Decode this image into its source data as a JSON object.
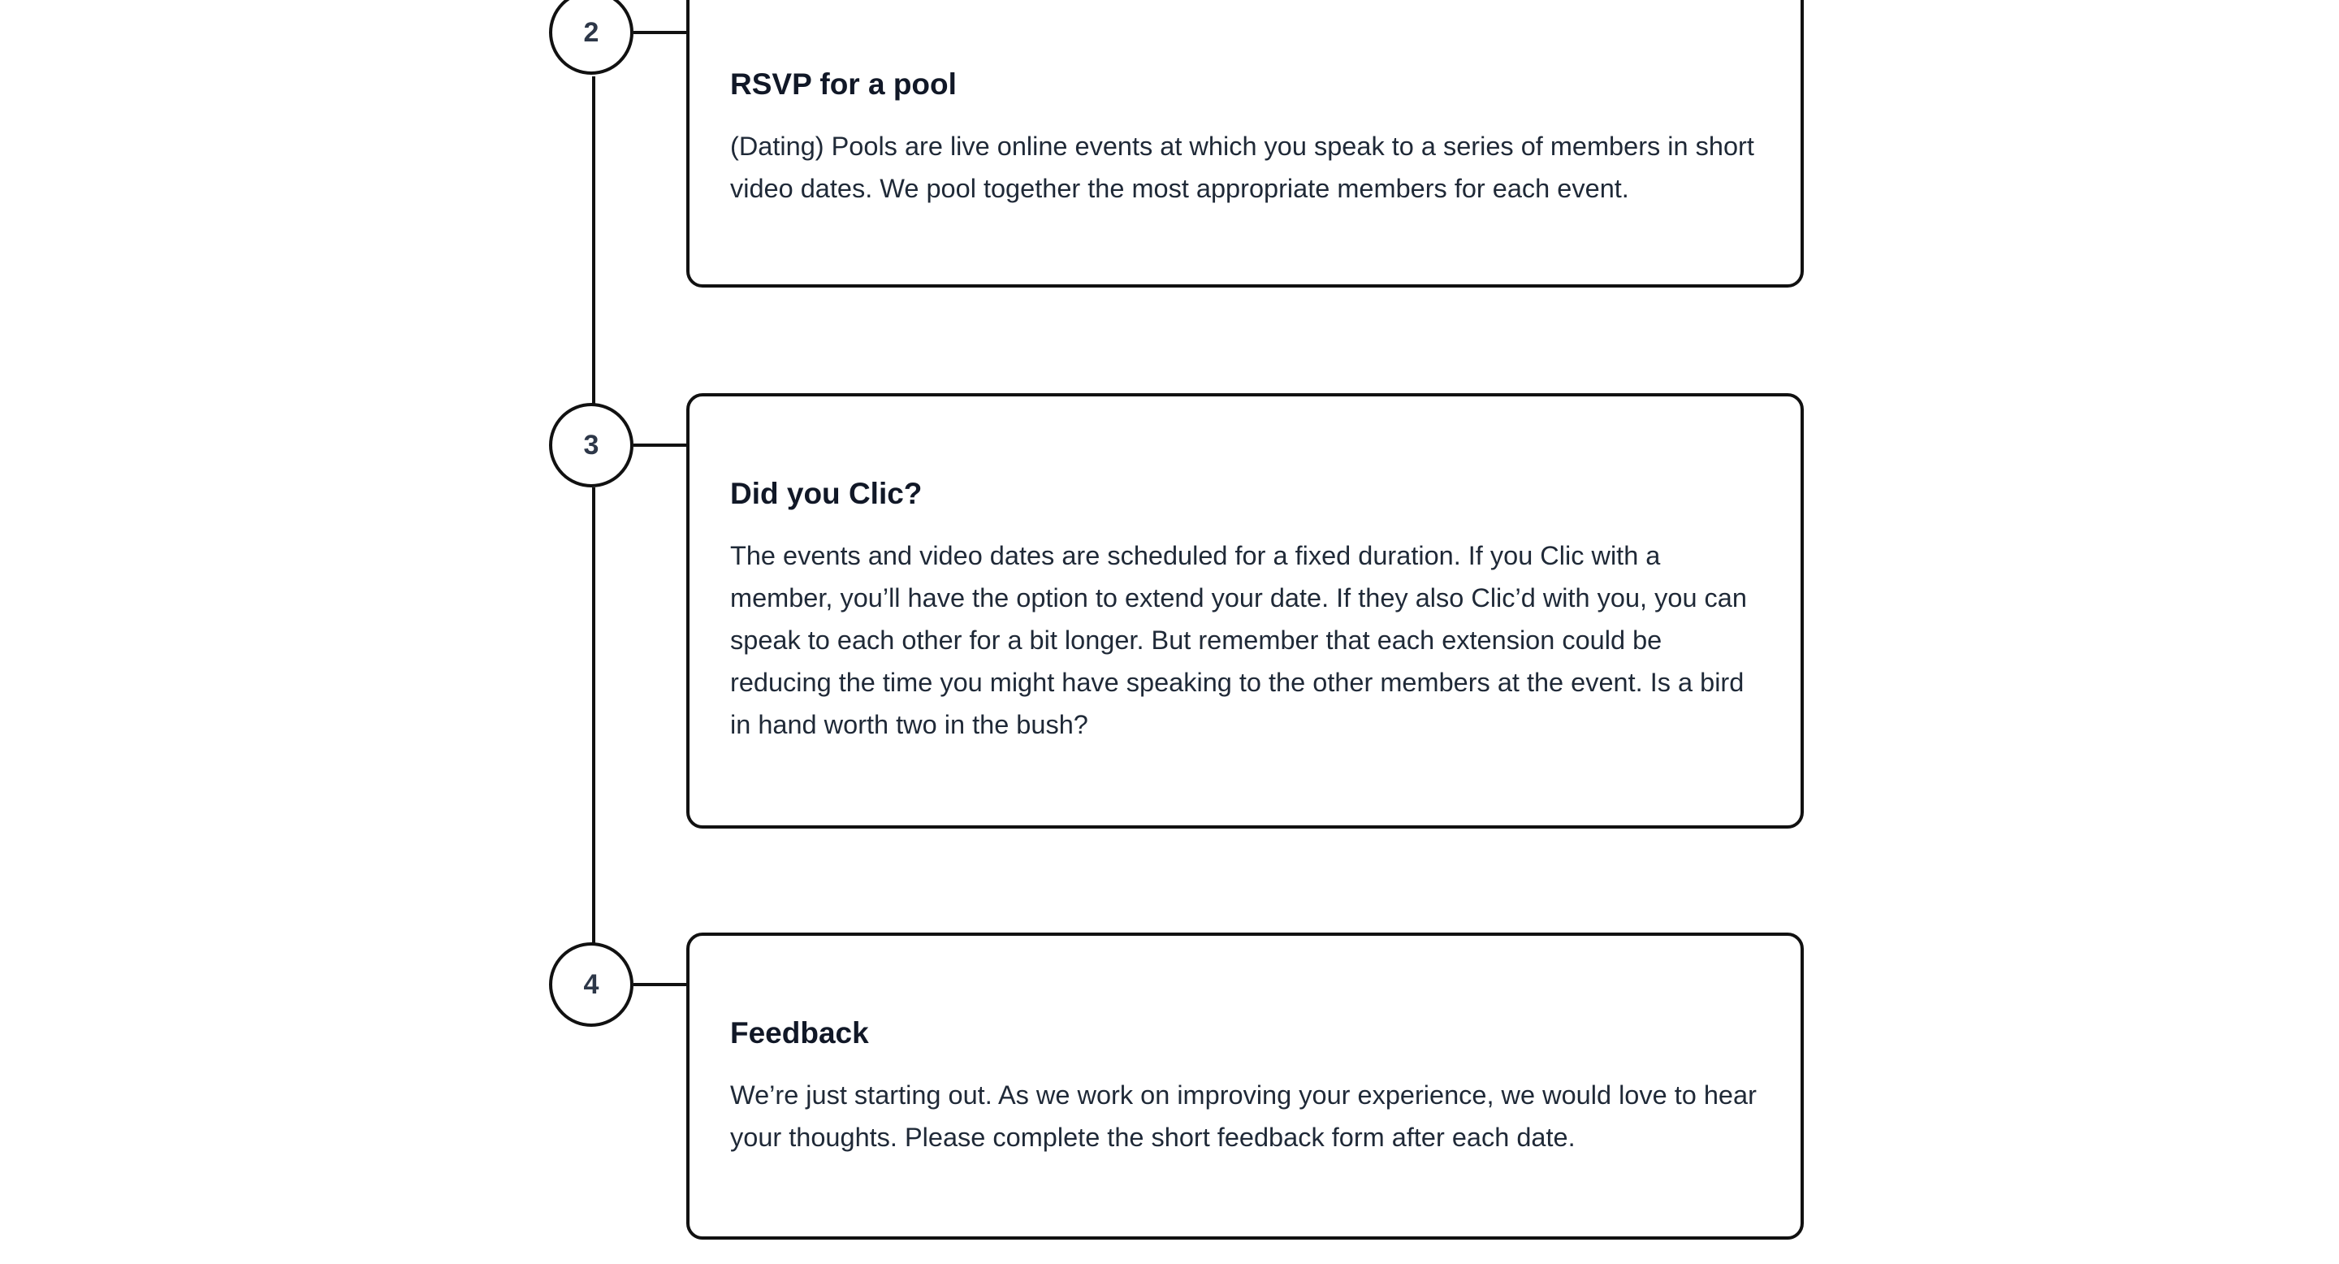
{
  "steps": [
    {
      "number": "2",
      "title": "RSVP for a pool",
      "body": "(Dating) Pools are live online events at which you speak to a series of members in short video dates. We pool together the most appropriate members for each event."
    },
    {
      "number": "3",
      "title": "Did you Clic?",
      "body": "The events and video dates are scheduled for a fixed duration. If you Clic with a member, you’ll have the option to extend your date. If they also Clic’d with you, you can speak to each other for a bit longer. But remember that each extension could be reducing the time you might have speaking to the other members at the event. Is a bird in hand worth two in the bush?"
    },
    {
      "number": "4",
      "title": "Feedback",
      "body": "We’re just starting out. As we work on improving your experience, we would love to hear your thoughts. Please complete the short feedback form after each date."
    }
  ]
}
